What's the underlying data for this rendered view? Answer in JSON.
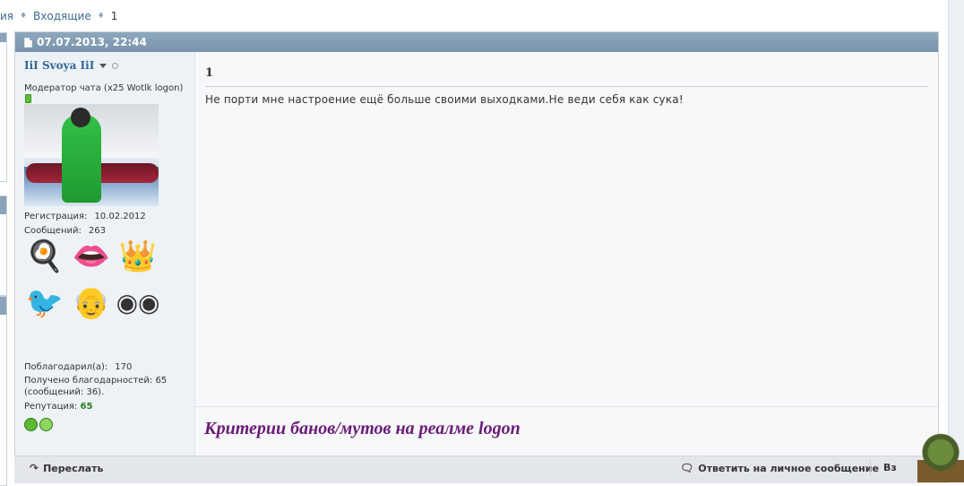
{
  "breadcrumb": {
    "prev_label": "ия",
    "inbox_label": "Входящие",
    "current_label": "1"
  },
  "post": {
    "date": "07.07.2013, 22:44",
    "title": "1",
    "text": "Не порти мне настроение ещё больше своими выходками.Не веди себя как сука!",
    "signature": "Критерии банов/мутов на реалме logon"
  },
  "user": {
    "name": "IiI Svoya IiI",
    "title": "Модератор чата (x25 Wotlk logon)",
    "registration_label": "Регистрация:",
    "registration_value": "10.02.2012",
    "posts_label": "Сообщений:",
    "posts_value": "263",
    "thanked_label": "Поблагодарил(а):",
    "thanked_value": "170",
    "thanks_received_line1": "Получено благодарностей: 65",
    "thanks_received_line2": "(сообщений: 36).",
    "reputation_label": "Репутация:",
    "reputation_value": "65",
    "awards": [
      "chef-hat-icon",
      "lips-icon",
      "crown-icon",
      "pirate-bird-icon",
      "bald-man-icon",
      "binoculars-icon"
    ]
  },
  "footer": {
    "forward_label": "Переслать",
    "reply_pm_label": "Ответить на личное сообщение",
    "more_label": "Вз"
  },
  "colors": {
    "header_bar": "#8ea7bd",
    "username": "#336699",
    "signature": "#6a1a78",
    "reputation": "#2a7d1c"
  }
}
